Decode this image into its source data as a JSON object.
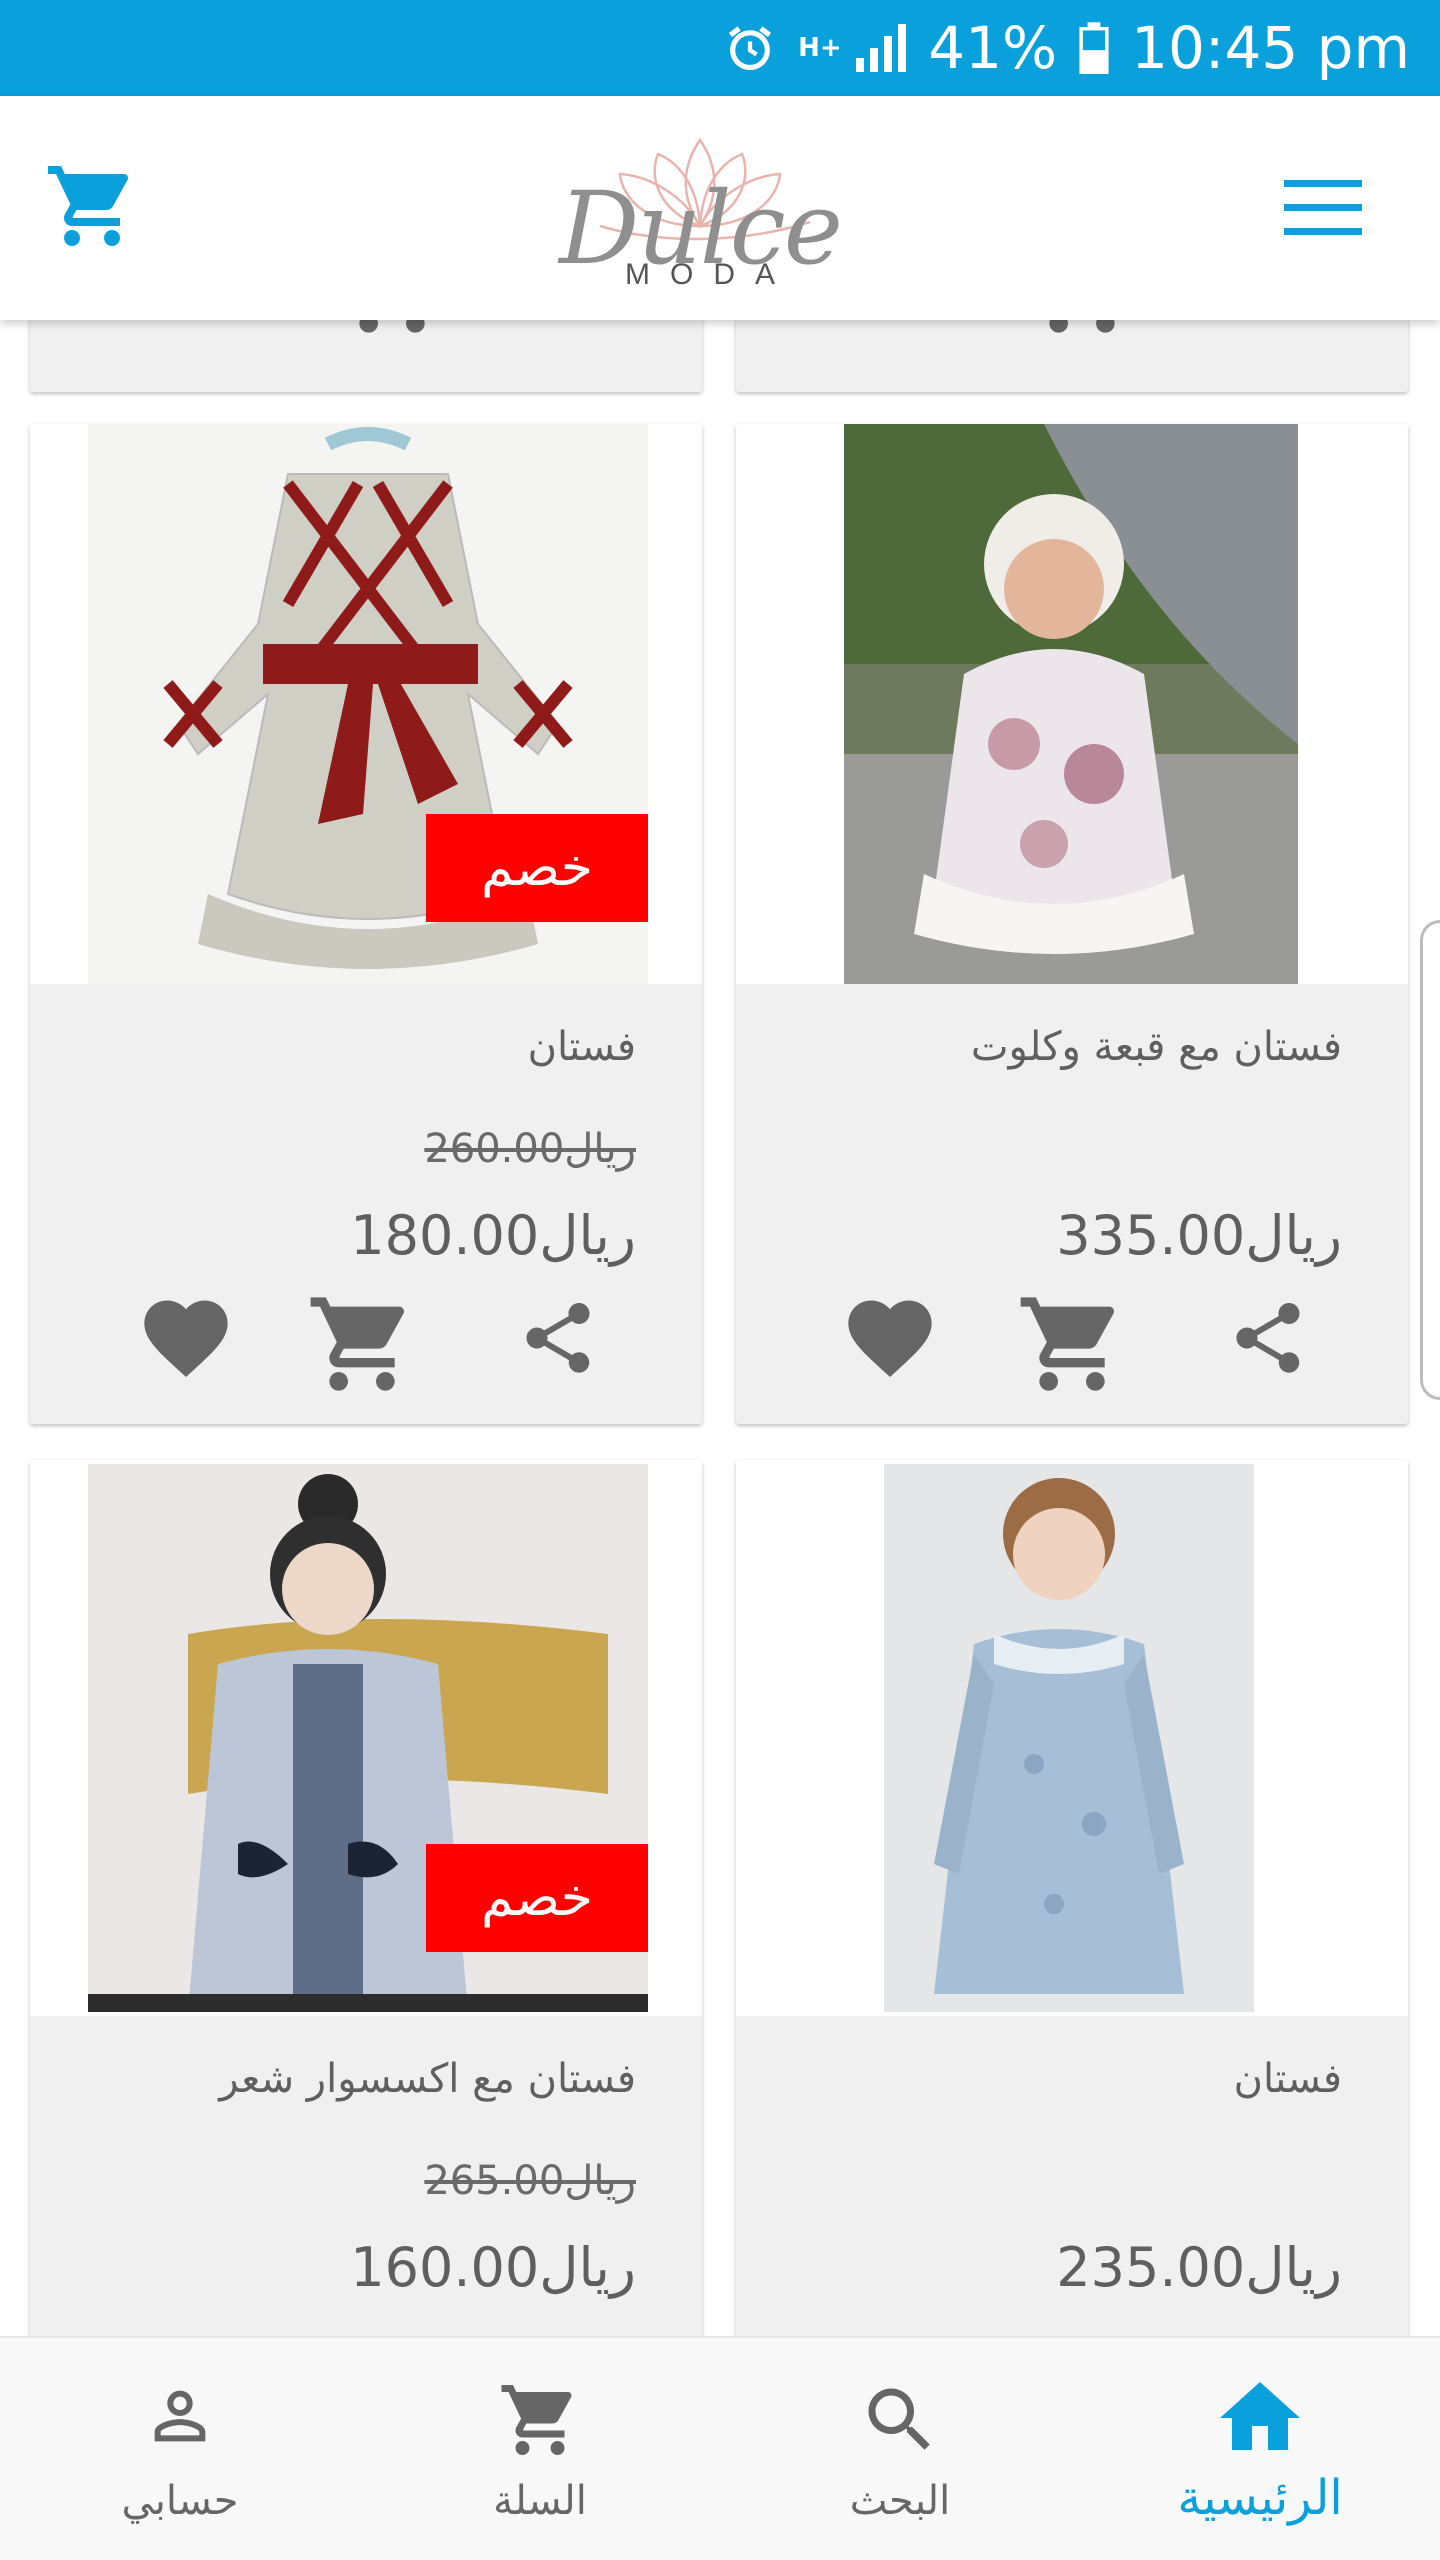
{
  "status_bar": {
    "battery": "41%",
    "time": "10:45 pm",
    "network": "H+"
  },
  "header": {
    "logo_name": "Dulce",
    "logo_sub": "MODA"
  },
  "products": [
    {
      "name": "فستان",
      "old_price": "260.00ريال",
      "price": "180.00ريال",
      "badge": "خصم"
    },
    {
      "name": "فستان مع قبعة وكلوت",
      "old_price": "",
      "price": "335.00ريال",
      "badge": ""
    },
    {
      "name": "فستان مع اكسسوار شعر",
      "old_price": "265.00ريال",
      "price": "160.00ريال",
      "badge": "خصم"
    },
    {
      "name": "فستان",
      "old_price": "",
      "price": "235.00ريال",
      "badge": ""
    }
  ],
  "bottom_nav": [
    {
      "label": "حسابي",
      "icon": "person-icon"
    },
    {
      "label": "السلة",
      "icon": "cart-icon"
    },
    {
      "label": "البحث",
      "icon": "search-icon"
    },
    {
      "label": "الرئيسية",
      "icon": "home-icon",
      "active": true
    }
  ],
  "colors": {
    "primary": "#0aa0dc",
    "discount": "#ff0000",
    "icon_gray": "#666666",
    "card_bg": "#f0f0f0"
  }
}
